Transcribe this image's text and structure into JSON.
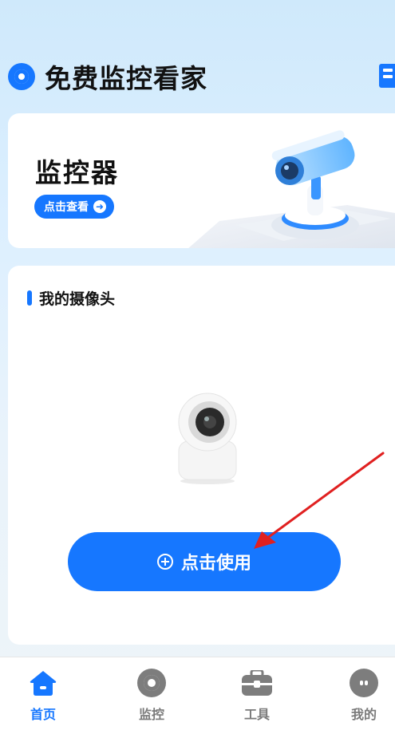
{
  "header": {
    "title": "免费监控看家"
  },
  "banner": {
    "title": "监控器",
    "button_label": "点击查看"
  },
  "cameras": {
    "section_title": "我的摄像头",
    "use_button_label": "点击使用"
  },
  "tabs": [
    {
      "label": "首页",
      "icon": "home-icon",
      "active": true
    },
    {
      "label": "监控",
      "icon": "monitor-icon",
      "active": false
    },
    {
      "label": "工具",
      "icon": "toolbox-icon",
      "active": false
    },
    {
      "label": "我的",
      "icon": "profile-icon",
      "active": false
    }
  ],
  "colors": {
    "accent": "#1677ff",
    "inactive": "#7a7a7a",
    "annotation_arrow": "#e02020"
  }
}
